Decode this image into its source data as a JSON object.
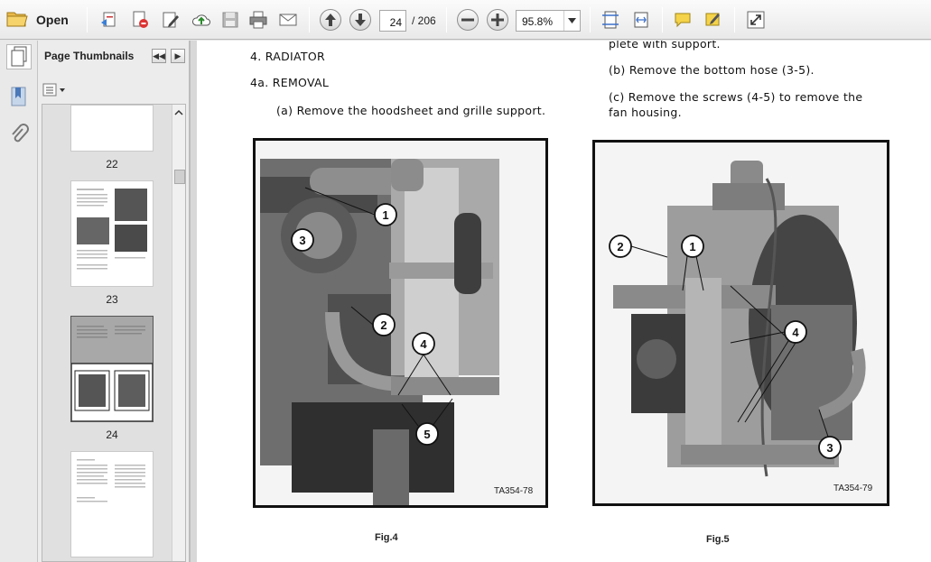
{
  "toolbar": {
    "open_label": "Open",
    "current_page": "24",
    "page_total": "/ 206",
    "zoom": "95.8%",
    "icons": [
      "open-folder-icon",
      "create-pdf-icon",
      "convert-icon",
      "edit-icon",
      "upload-icon",
      "save-icon",
      "print-icon",
      "email-icon",
      "page-up-icon",
      "page-down-icon",
      "zoom-out-icon",
      "zoom-in-icon",
      "fit-page-icon",
      "fit-width-icon",
      "comment-icon",
      "highlight-icon",
      "expand-icon"
    ]
  },
  "sidebar": {
    "panel_title": "Page Thumbnails",
    "pages": [
      {
        "label": "22"
      },
      {
        "label": "23"
      },
      {
        "label": "24"
      }
    ]
  },
  "document": {
    "left_column": {
      "heading": "4. RADIATOR",
      "subheading": "4a. REMOVAL",
      "step_a": "(a)  Remove the hoodsheet and grille support."
    },
    "right_column": {
      "continuation": "plete with support.",
      "step_b": "(b)  Remove the bottom hose (3-5).",
      "step_c_line1": "(c)  Remove  the  screws  (4-5)  to  remove  the",
      "step_c_line2": "fan housing."
    },
    "figures": [
      {
        "caption": "Fig.4",
        "ref": "TA354-78",
        "callouts": [
          "1",
          "2",
          "3",
          "4",
          "5"
        ]
      },
      {
        "caption": "Fig.5",
        "ref": "TA354-79",
        "callouts": [
          "1",
          "2",
          "3",
          "4"
        ]
      }
    ]
  }
}
